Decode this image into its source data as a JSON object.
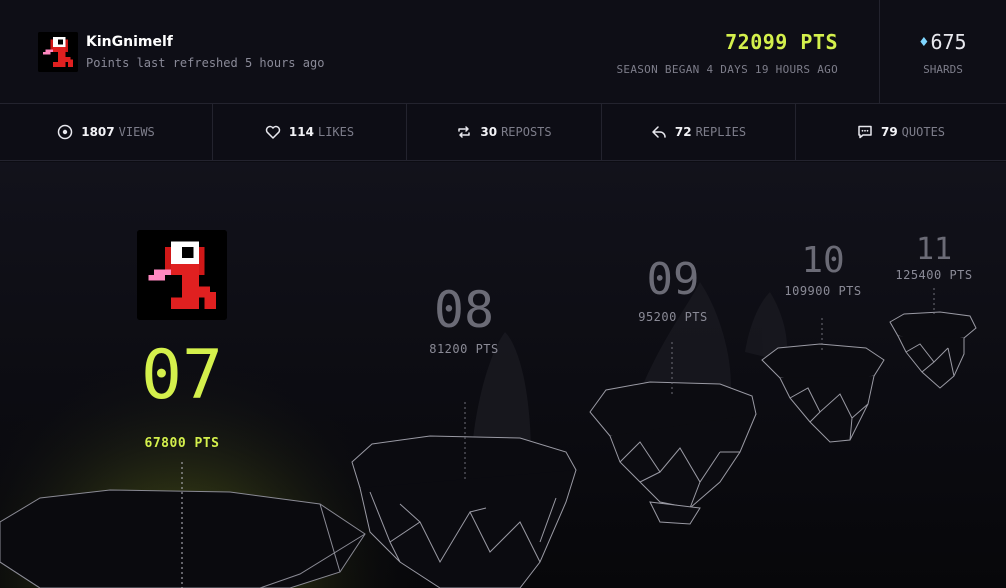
{
  "user": {
    "name": "KinGnimelf",
    "refreshed": "Points last refreshed 5 hours ago"
  },
  "summary": {
    "points": "72099 PTS",
    "season": "SEASON BEGAN 4 DAYS 19 HOURS AGO",
    "shards_value": "675",
    "shards_label": "SHARDS"
  },
  "stats": [
    {
      "icon": "eye-icon",
      "value": "1807",
      "label": "VIEWS"
    },
    {
      "icon": "heart-icon",
      "value": "114",
      "label": "LIKES"
    },
    {
      "icon": "repost-icon",
      "value": "30",
      "label": "REPOSTS"
    },
    {
      "icon": "reply-icon",
      "value": "72",
      "label": "REPLIES"
    },
    {
      "icon": "quote-icon",
      "value": "79",
      "label": "QUOTES"
    }
  ],
  "leaderboard": [
    {
      "rank": "07",
      "points": "67800 PTS",
      "current": true
    },
    {
      "rank": "08",
      "points": "81200 PTS",
      "current": false
    },
    {
      "rank": "09",
      "points": "95200 PTS",
      "current": false
    },
    {
      "rank": "10",
      "points": "109900 PTS",
      "current": false
    },
    {
      "rank": "11",
      "points": "125400 PTS",
      "current": false
    }
  ],
  "colors": {
    "accent": "#d4f04c",
    "background": "#0c0c12",
    "muted": "#7d7d8a",
    "shard": "#7fd6ff"
  }
}
